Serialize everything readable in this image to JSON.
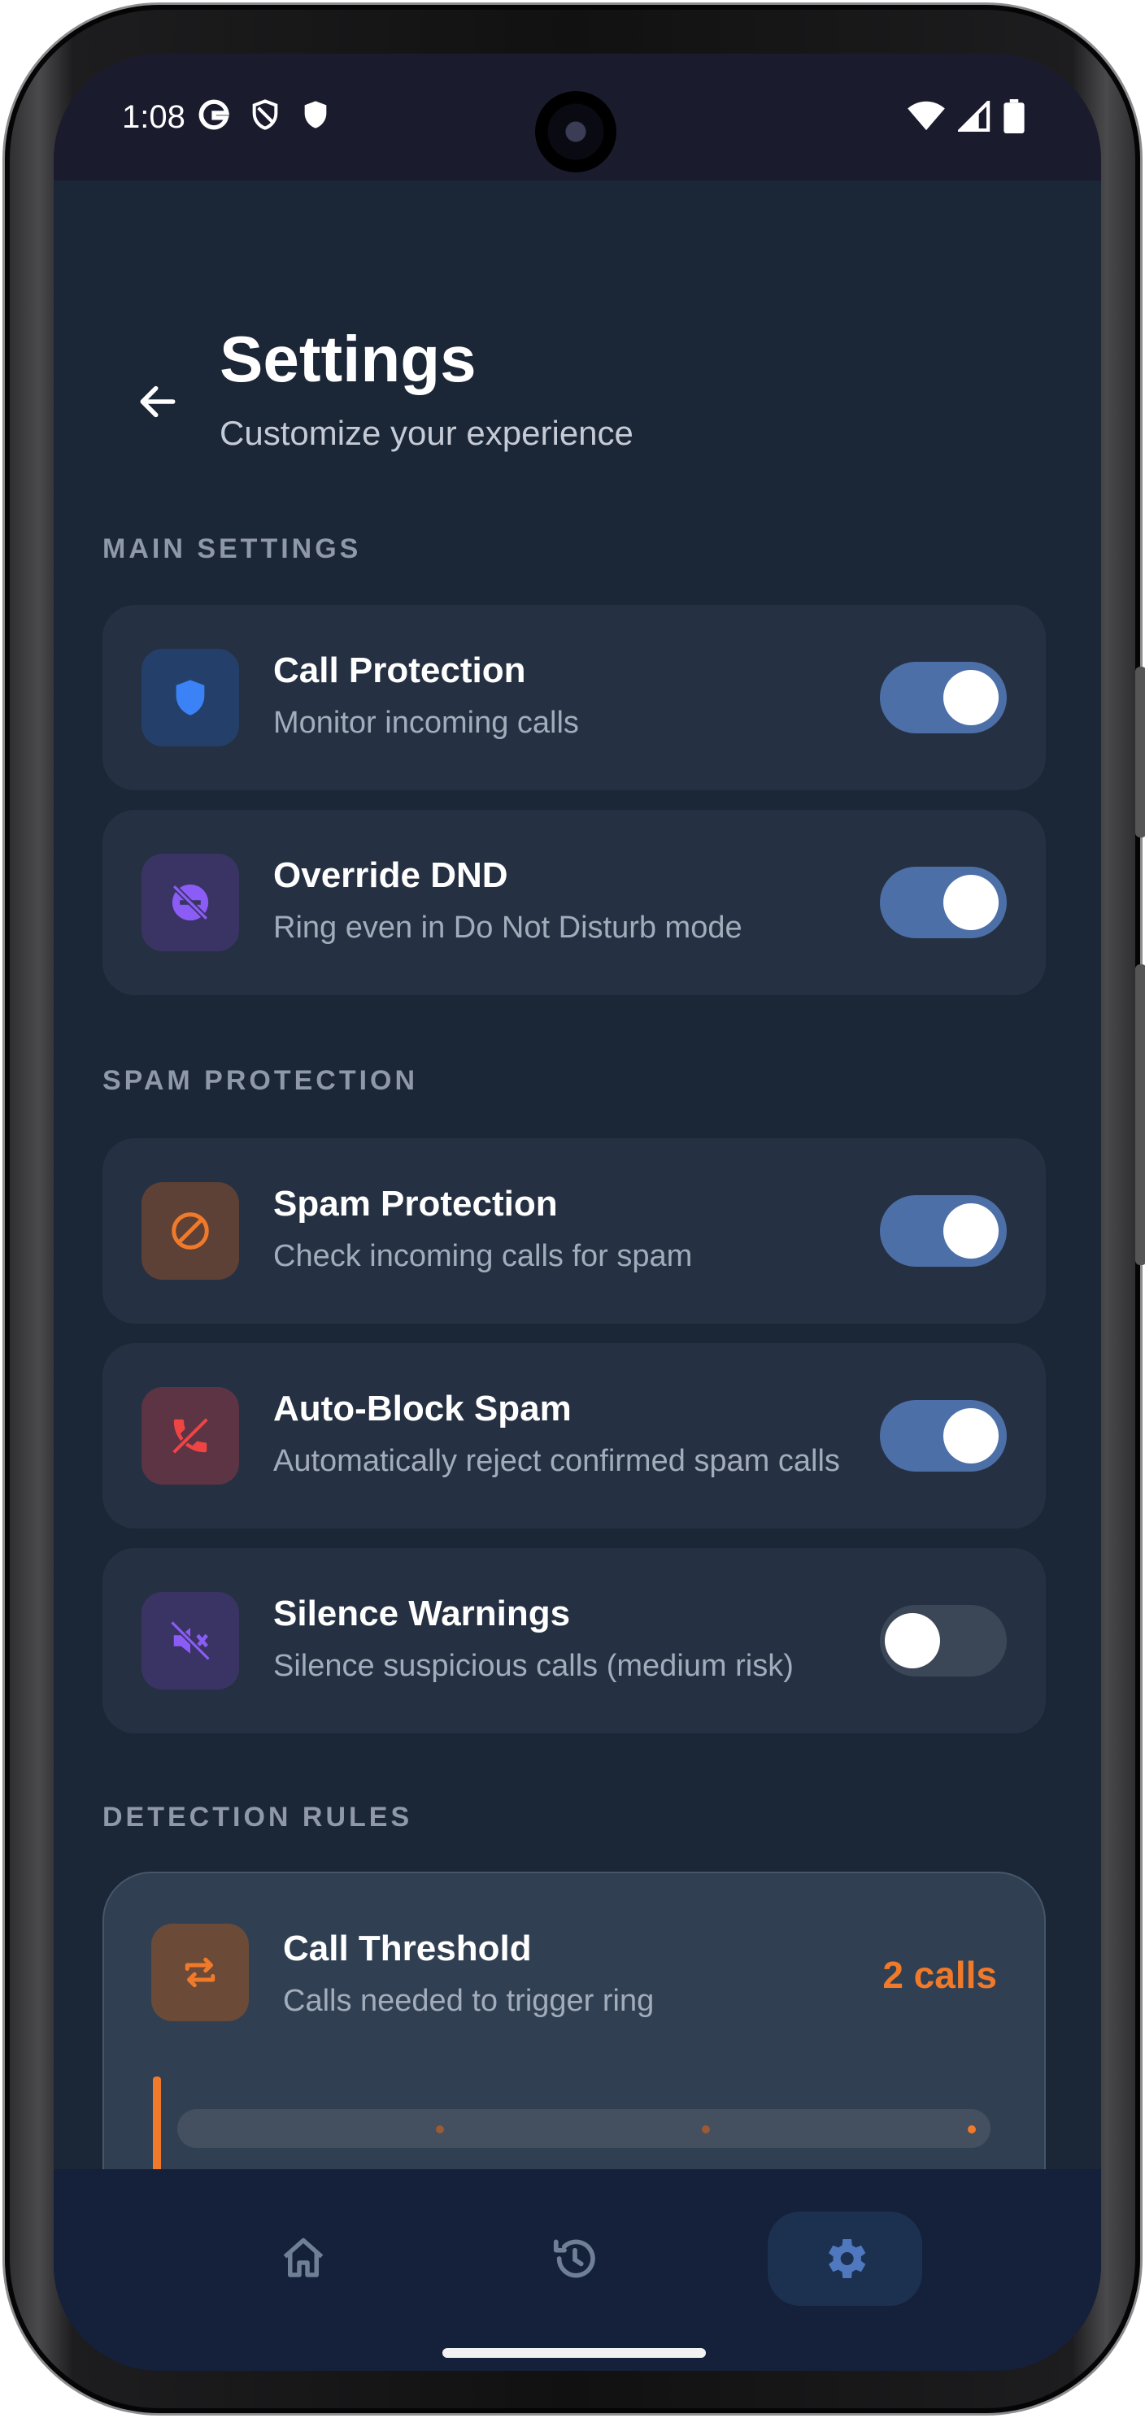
{
  "status_bar": {
    "time": "1:08",
    "left_icons": [
      "google-icon",
      "shield-outline-icon",
      "shield-filled-icon"
    ],
    "right_icons": [
      "wifi-icon",
      "cell-signal-icon",
      "battery-icon"
    ]
  },
  "header": {
    "title": "Settings",
    "subtitle": "Customize your experience"
  },
  "sections": {
    "main": "MAIN SETTINGS",
    "spam": "SPAM PROTECTION",
    "detection": "DETECTION RULES"
  },
  "settings": {
    "call_protection": {
      "title": "Call Protection",
      "desc": "Monitor incoming calls",
      "enabled": true,
      "icon": "shield-icon",
      "color": "#3b82f6"
    },
    "override_dnd": {
      "title": "Override DND",
      "desc": "Ring even in Do Not Disturb mode",
      "enabled": true,
      "icon": "dnd-off-icon",
      "color": "#8b5cf6"
    },
    "spam_protection": {
      "title": "Spam Protection",
      "desc": "Check incoming calls for spam",
      "enabled": true,
      "icon": "block-icon",
      "color": "#f07a2a"
    },
    "auto_block": {
      "title": "Auto-Block Spam",
      "desc": "Automatically reject confirmed spam calls",
      "enabled": true,
      "icon": "phone-off-icon",
      "color": "#ef4444"
    },
    "silence_warnings": {
      "title": "Silence Warnings",
      "desc": "Silence suspicious calls (medium risk)",
      "enabled": false,
      "icon": "volume-off-icon",
      "color": "#8b5cf6"
    }
  },
  "threshold": {
    "title": "Call Threshold",
    "desc": "Calls needed to trigger ring",
    "value_label": "2 calls",
    "accent": "#f07a2a",
    "icon": "repeat-icon"
  },
  "bottom_nav": {
    "items": [
      "home-icon",
      "history-icon",
      "settings-icon"
    ],
    "active": "settings"
  }
}
